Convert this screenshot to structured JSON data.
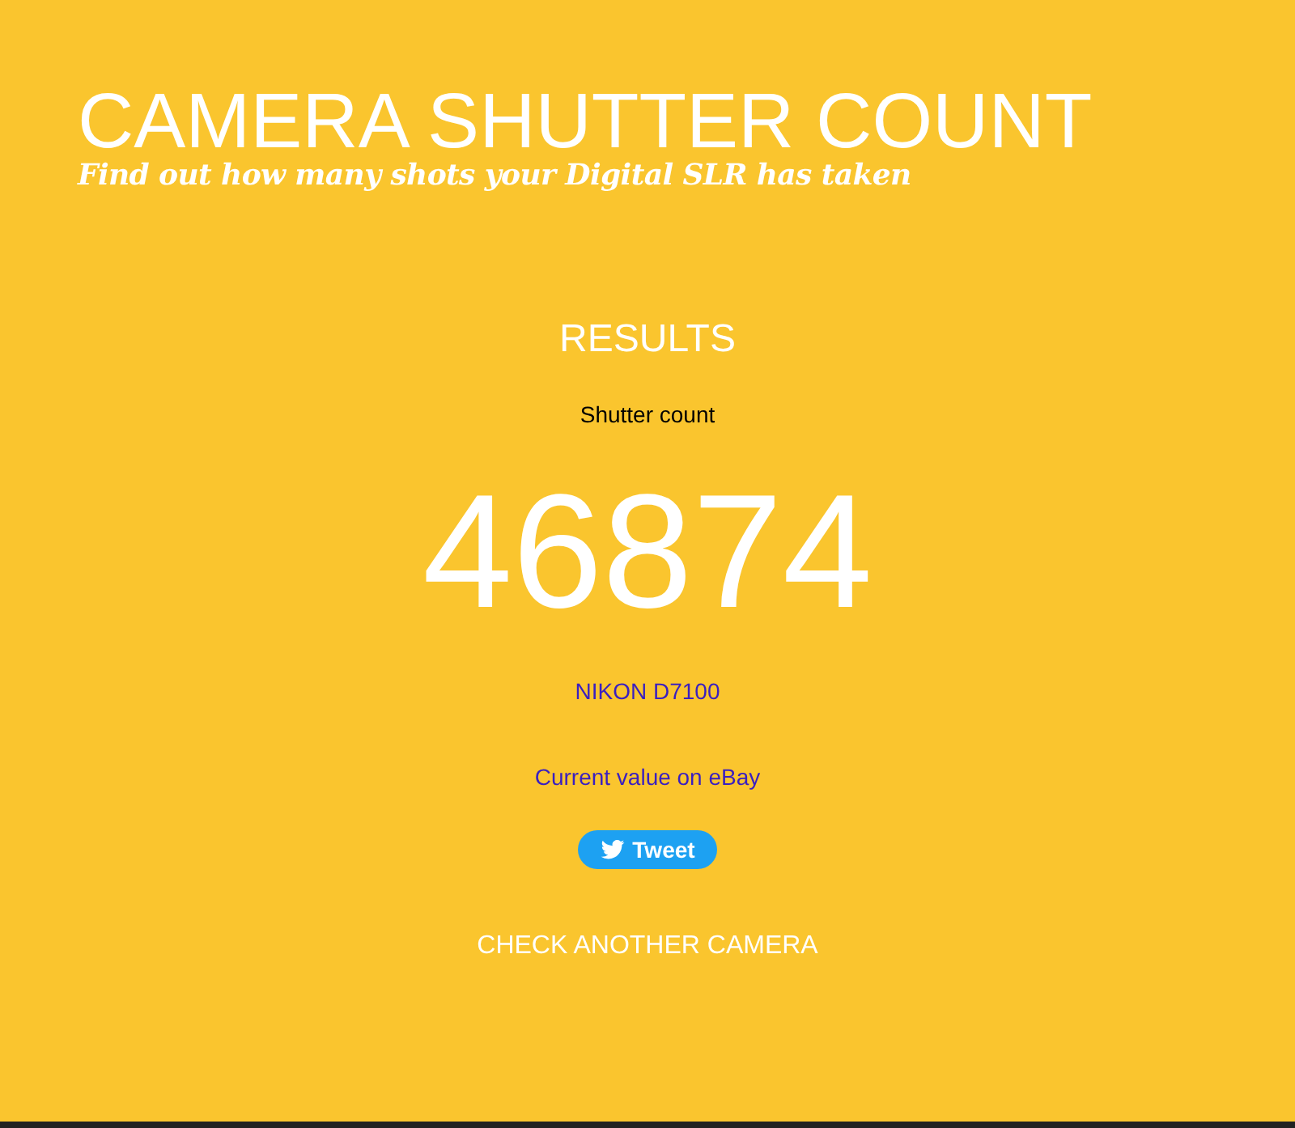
{
  "header": {
    "title": "CAMERA SHUTTER COUNT",
    "subtitle": "Find out how many shots your Digital SLR has taken"
  },
  "results": {
    "heading": "RESULTS",
    "label": "Shutter count",
    "count": "46874",
    "camera_link": "NIKON D7100",
    "ebay_link": "Current value on eBay",
    "tweet_button": "Tweet",
    "check_another": "CHECK ANOTHER CAMERA"
  }
}
